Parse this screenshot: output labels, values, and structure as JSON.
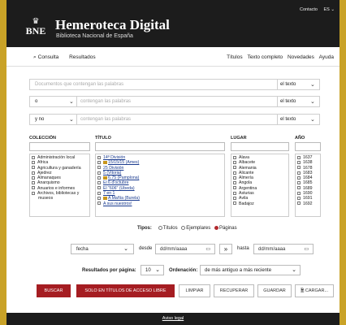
{
  "header": {
    "logo_text": "BNE",
    "site_title": "Hemeroteca Digital",
    "site_subtitle": "Biblioteca Nacional de España",
    "contact_label": "Contacto",
    "lang_label": "ES"
  },
  "nav": {
    "consulta": "Consulta",
    "resultados": "Resultados",
    "right_items": [
      "Títulos",
      "Texto completo",
      "Novedades",
      "Ayuda"
    ]
  },
  "search_rows": [
    {
      "operator": "",
      "placeholder": "Documentos que contengan las palabras",
      "scope": "el texto"
    },
    {
      "operator": "o",
      "placeholder": "contengan las palabras",
      "scope": "el texto"
    },
    {
      "operator": "y no",
      "placeholder": "contengan las palabras",
      "scope": "el texto"
    }
  ],
  "filters": {
    "coleccion": {
      "label": "COLECCIÓN",
      "items": [
        "Administración local",
        "África",
        "Agricultura y ganadería",
        "Ajedrez",
        "Almanaques",
        "Anarquismo",
        "Anuarios e informes",
        "Archivos, bibliotecas y museos"
      ]
    },
    "titulo": {
      "label": "TÍTULO",
      "items": [
        "14ª División",
        "15/15/15 (Ames)",
        "25 División",
        "5 (Vitoria)",
        "6.75 (Pamplona)",
        "El 6 d'octubre",
        "El \"606\" (Úbeda)",
        "7 en 1",
        "A Mañía (Burela)",
        "A sus nuestros!"
      ]
    },
    "lugar": {
      "label": "LUGAR",
      "items": [
        "Álava",
        "Albacete",
        "Alemania",
        "Alicante",
        "Almería",
        "Angola",
        "Argentina",
        "Asturias",
        "Ávila",
        "Badajoz"
      ]
    },
    "anio": {
      "label": "AÑO",
      "items": [
        "1637",
        "1638",
        "1678",
        "1683",
        "1684",
        "1685",
        "1689",
        "1690",
        "1691",
        "1692"
      ]
    }
  },
  "tipos": {
    "label": "Tipos:",
    "options": [
      "Títulos",
      "Ejemplares",
      "Páginas"
    ],
    "selected": "Páginas"
  },
  "date": {
    "field": "fecha",
    "desde_label": "desde",
    "desde_placeholder": "dd/mm/aaaa",
    "hasta_label": "hasta",
    "hasta_placeholder": "dd/mm/aaaa",
    "arrow": "»"
  },
  "results": {
    "per_page_label": "Resultados por página:",
    "per_page_value": "10",
    "order_label": "Ordenación:",
    "order_value": "de más antiguo a más reciente"
  },
  "buttons": {
    "buscar": "BUSCAR",
    "libre": "SOLO EN TÍTULOS DE ACCESO LIBRE",
    "limpiar": "LIMPIAR",
    "recuperar": "RECUPERAR",
    "guardar": "GUARDAR",
    "cargar": "CARGAR..."
  },
  "footer": {
    "aviso": "Aviso legal"
  },
  "colors": {
    "accent": "#a51d22",
    "header_bg": "#1c1c1c",
    "page_border": "#c9a227"
  }
}
